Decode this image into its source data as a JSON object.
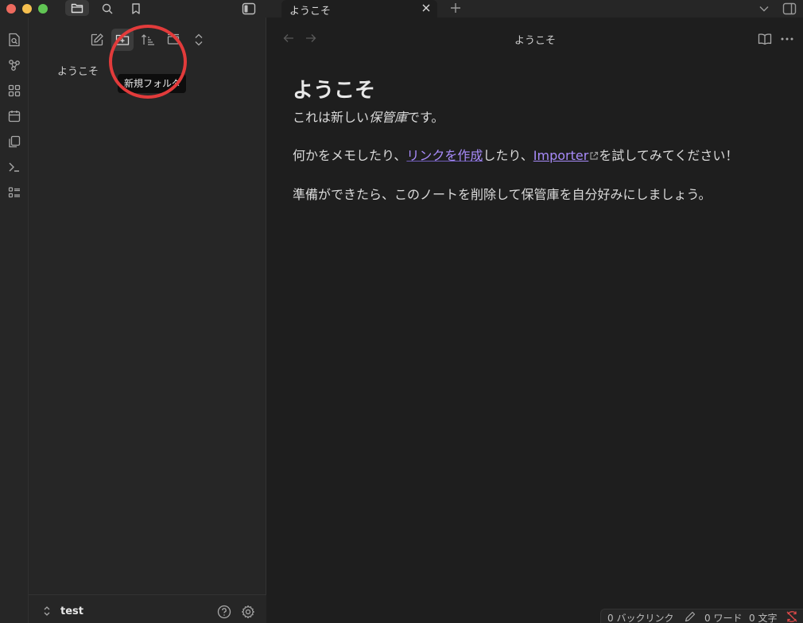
{
  "tab": {
    "title": "ようこそ"
  },
  "sidebar": {
    "files": [
      {
        "label": "ようこそ"
      }
    ],
    "tooltip": "新規フォルダ",
    "vault_name": "test"
  },
  "editor": {
    "view_title": "ようこそ",
    "heading": "ようこそ",
    "para1": {
      "before": "これは新しい",
      "em": "保管庫",
      "after": "です。"
    },
    "para2": {
      "before": "何かをメモしたり、",
      "internal_link": "リンクを作成",
      "middle": "したり、",
      "external_link": "Importer",
      "after": "を試してみてください！"
    },
    "para3": "準備ができたら、このノートを削除して保管庫を自分好みにしましょう。"
  },
  "status": {
    "backlinks": "0 バックリンク",
    "words": "0 ワード",
    "chars": "0 文字"
  },
  "colors": {
    "accent": "#a88bfa",
    "highlight": "#e23b3b",
    "background": "#1e1e1e",
    "sidebar": "#262626"
  },
  "icons": {
    "titlebar": [
      "folder-icon",
      "search-icon",
      "bookmark-icon",
      "sidebar-toggle-icon",
      "close-icon",
      "plus-icon",
      "chevron-down-icon",
      "right-sidebar-icon"
    ],
    "ribbon": [
      "quick-switcher-icon",
      "graph-icon",
      "canvas-icon",
      "calendar-icon",
      "templates-icon",
      "command-palette-icon",
      "bases-icon"
    ],
    "nav": [
      "new-note-icon",
      "new-folder-icon",
      "sort-icon",
      "auto-reveal-icon",
      "collapse-all-icon"
    ]
  }
}
